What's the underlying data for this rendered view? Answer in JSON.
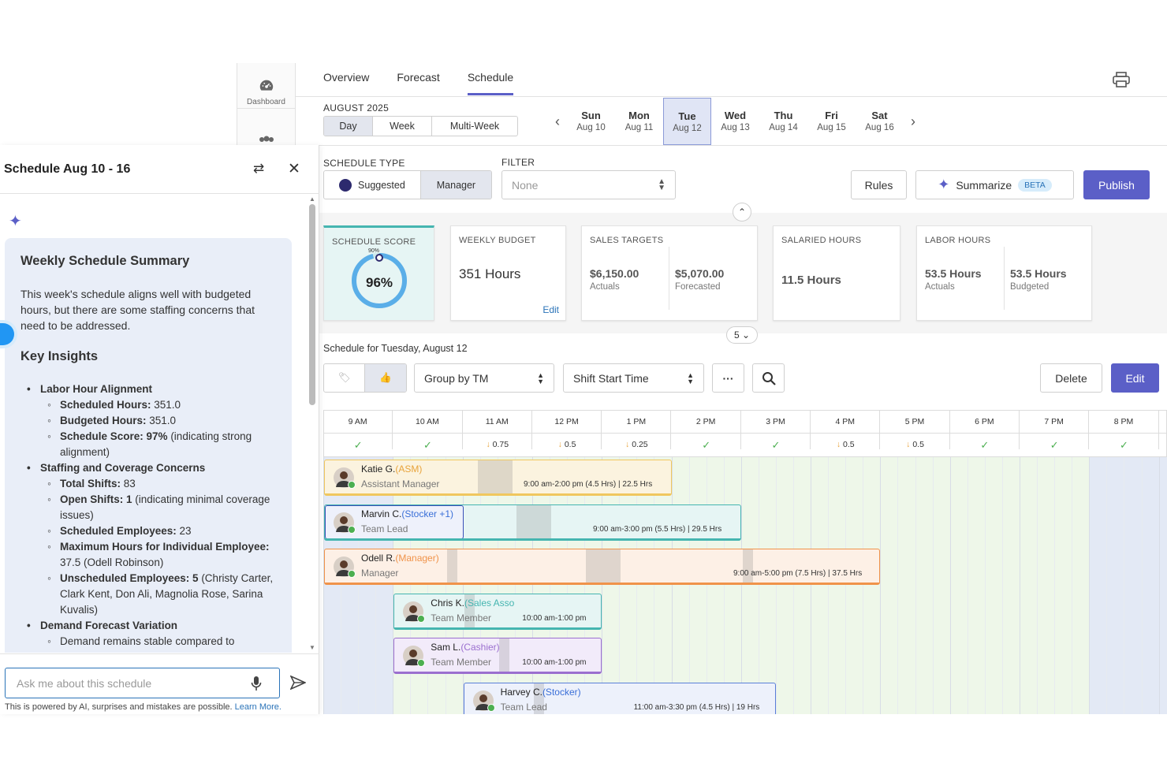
{
  "rail": {
    "dashboard": "Dashboard"
  },
  "tabs": [
    "Overview",
    "Forecast",
    "Schedule"
  ],
  "month": "AUGUST 2025",
  "view_modes": [
    "Day",
    "Week",
    "Multi-Week"
  ],
  "days": [
    {
      "d": "Sun",
      "date": "Aug 10"
    },
    {
      "d": "Mon",
      "date": "Aug 11"
    },
    {
      "d": "Tue",
      "date": "Aug 12"
    },
    {
      "d": "Wed",
      "date": "Aug 13"
    },
    {
      "d": "Thu",
      "date": "Aug 14"
    },
    {
      "d": "Fri",
      "date": "Aug 15"
    },
    {
      "d": "Sat",
      "date": "Aug 16"
    }
  ],
  "schedule_type": {
    "label": "SCHEDULE TYPE",
    "options": [
      "Suggested",
      "Manager"
    ]
  },
  "filter": {
    "label": "FILTER",
    "value": "None"
  },
  "actions": {
    "rules": "Rules",
    "summarize": "Summarize",
    "beta": "BETA",
    "publish": "Publish"
  },
  "kpis": {
    "score": {
      "title": "SCHEDULE SCORE",
      "value": "96%",
      "marker": "90%",
      "fraction": 0.96
    },
    "budget": {
      "title": "WEEKLY BUDGET",
      "value": "351 Hours",
      "edit": "Edit"
    },
    "sales": {
      "title": "SALES TARGETS",
      "actual": "$6,150.00",
      "actual_label": "Actuals",
      "forecast": "$5,070.00",
      "forecast_label": "Forecasted"
    },
    "salaried": {
      "title": "SALARIED HOURS",
      "value": "11.5 Hours"
    },
    "labor": {
      "title": "LABOR HOURS",
      "actual": "53.5 Hours",
      "actual_label": "Actuals",
      "budget": "53.5 Hours",
      "budget_label": "Budgeted"
    }
  },
  "collapse_count": "5",
  "schedule_for": "Schedule for Tuesday, August 12",
  "toolbar": {
    "group": "Group by TM",
    "sort": "Shift Start Time",
    "delete": "Delete",
    "edit": "Edit"
  },
  "hours": [
    "9 AM",
    "10 AM",
    "11 AM",
    "12 PM",
    "1 PM",
    "2 PM",
    "3 PM",
    "4 PM",
    "5 PM",
    "6 PM",
    "7 PM",
    "8 PM"
  ],
  "coverage": [
    "",
    "",
    "0.75",
    "0.5",
    "0.25",
    "",
    "",
    "0.5",
    "0.5",
    "",
    "",
    ""
  ],
  "shifts": [
    {
      "name": "Katie G.",
      "tag": "(ASM)",
      "role": "Assistant Manager",
      "time": "9:00 am-2:00 pm (4.5 Hrs) | 22.5 Hrs",
      "color": "#f0c75e",
      "bg": "#fbf3df",
      "tagcolor": "#e8a33a"
    },
    {
      "name": "Marvin C.",
      "tag": "(Stocker +1)",
      "role": "Team Lead",
      "time": "9:00 am-3:00 pm (5.5 Hrs) | 29.5 Hrs",
      "color": "#45b5b0",
      "bg": "#e6f5f4",
      "tagcolor": "#3a6fd8"
    },
    {
      "name": "Odell R.",
      "tag": "(Manager)",
      "role": "Manager",
      "time": "9:00 am-5:00 pm (7.5 Hrs) | 37.5 Hrs",
      "color": "#f0934a",
      "bg": "#fdf0e6",
      "tagcolor": "#f0934a"
    },
    {
      "name": "Chris K.",
      "tag": "(Sales Asso",
      "role": "Team Member",
      "time": "10:00 am-1:00 pm",
      "color": "#45b5b0",
      "bg": "#e6f5f4",
      "tagcolor": "#45b5b0"
    },
    {
      "name": "Sam L.",
      "tag": "(Cashier)",
      "role": "Team Member",
      "time": "10:00 am-1:00 pm",
      "color": "#9b6fcf",
      "bg": "#f2ebfa",
      "tagcolor": "#9b6fcf"
    },
    {
      "name": "Harvey C.",
      "tag": "(Stocker)",
      "role": "Team Lead",
      "time": "11:00 am-3:30 pm (4.5 Hrs) | 19 Hrs",
      "color": "#5a7fd8",
      "bg": "#edf1fb",
      "tagcolor": "#3a6fd8"
    }
  ],
  "panel": {
    "title": "Schedule Aug 10 - 16",
    "summary_title": "Weekly Schedule Summary",
    "intro": "This week's schedule aligns well with budgeted hours, but there are some staffing concerns that need to be addressed.",
    "insights_title": "Key Insights",
    "items": [
      {
        "t": "l1",
        "text": "Labor Hour Alignment"
      },
      {
        "t": "l2",
        "b": "Scheduled Hours:",
        "text": " 351.0"
      },
      {
        "t": "l2",
        "b": "Budgeted Hours:",
        "text": " 351.0"
      },
      {
        "t": "l2",
        "b": "Schedule Score: 97%",
        "text": " (indicating strong alignment)"
      },
      {
        "t": "l1",
        "text": "Staffing and Coverage Concerns"
      },
      {
        "t": "l2",
        "b": "Total Shifts:",
        "text": " 83"
      },
      {
        "t": "l2",
        "b": "Open Shifts: 1",
        "text": " (indicating minimal coverage issues)"
      },
      {
        "t": "l2",
        "b": "Scheduled Employees:",
        "text": " 23"
      },
      {
        "t": "l2",
        "b": "Maximum Hours for Individual Employee:",
        "text": " 37.5 (Odell Robinson)"
      },
      {
        "t": "l2",
        "b": "Unscheduled Employees: 5",
        "text": " (Christy Carter, Clark Kent, Don Ali, Magnolia Rose, Sarina Kuvalis)"
      },
      {
        "t": "l1",
        "text": "Demand Forecast Variation"
      },
      {
        "t": "l2",
        "b": "",
        "text": "Demand remains stable compared to"
      }
    ],
    "ask_placeholder": "Ask me about this schedule",
    "disclaimer": "This is powered by AI, surprises and mistakes are possible.",
    "learn_more": "Learn More."
  },
  "colors": {
    "accent": "#5b5fc7",
    "check": "#4caf50",
    "arrow": "#e8a33a"
  }
}
